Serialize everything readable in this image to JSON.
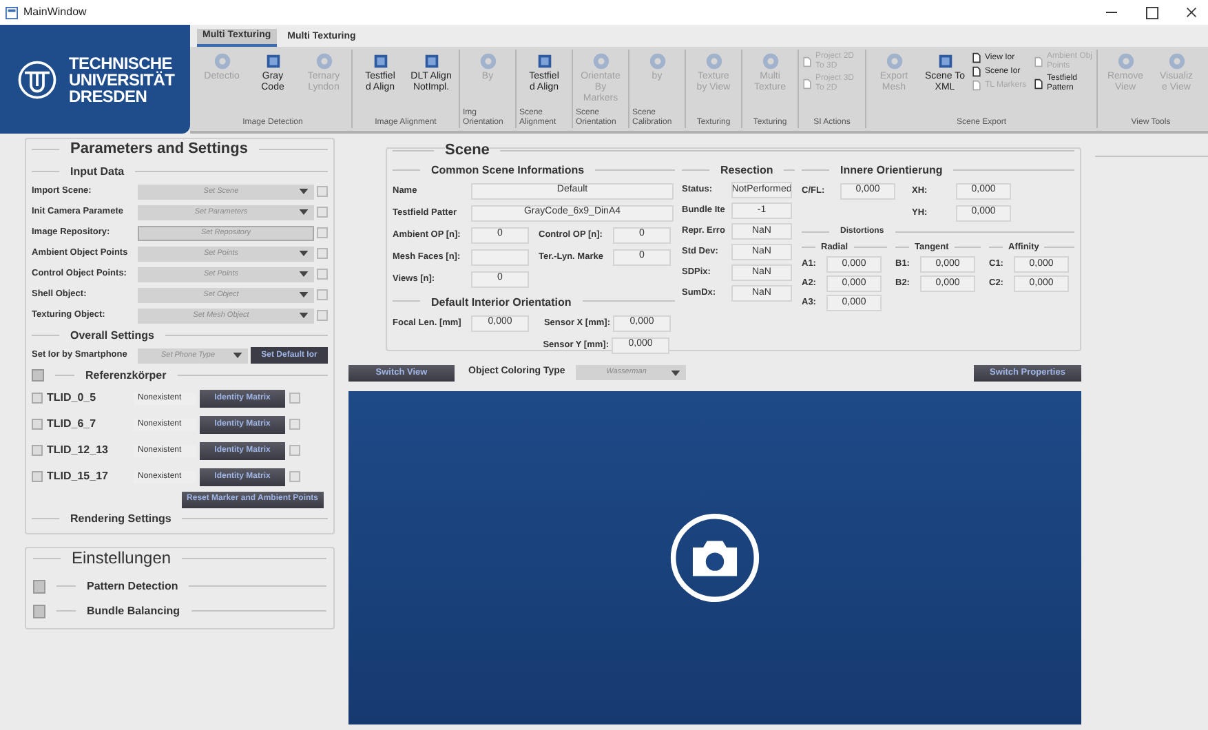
{
  "window": {
    "title": "MainWindow"
  },
  "logo": {
    "lines": [
      "TECHNISCHE",
      "UNIVERSITÄT",
      "DRESDEN"
    ]
  },
  "ribbon_tabs": [
    {
      "label": "Multi Texturing",
      "selected": true
    },
    {
      "label": "Multi Texturing",
      "selected": false
    }
  ],
  "toolbar_groups": [
    {
      "label": "Image Detection",
      "buttons": [
        {
          "kind": "large",
          "label": "Detectio",
          "disabled": true
        },
        {
          "kind": "large",
          "label": "Gray\nCode",
          "disabled": false
        },
        {
          "kind": "large",
          "label": "Ternary\nLyndon",
          "disabled": true
        }
      ]
    },
    {
      "label": "Image Alignment",
      "buttons": [
        {
          "kind": "large",
          "label": "Testfiel\nd Align",
          "disabled": false
        },
        {
          "kind": "large",
          "label": "DLT Align\nNotImpl.",
          "disabled": false
        }
      ]
    },
    {
      "label": "Img Orientation",
      "buttons": [
        {
          "kind": "large",
          "label": "By",
          "disabled": true
        }
      ]
    },
    {
      "label": "Scene Alignment",
      "buttons": [
        {
          "kind": "large",
          "label": "Testfiel\nd Align",
          "disabled": false
        }
      ]
    },
    {
      "label": "Scene Orientation",
      "buttons": [
        {
          "kind": "large",
          "label": "Orientate By\nMarkers",
          "disabled": true
        }
      ]
    },
    {
      "label": "Scene Calibration",
      "buttons": [
        {
          "kind": "large",
          "label": "by",
          "disabled": true
        }
      ]
    },
    {
      "label": "Texturing",
      "buttons": [
        {
          "kind": "large",
          "label": "Texture\nby View",
          "disabled": true
        }
      ]
    },
    {
      "label": "Texturing",
      "buttons": [
        {
          "kind": "large",
          "label": "Multi\nTexture",
          "disabled": true
        }
      ]
    },
    {
      "label": "SI Actions",
      "buttons": [
        {
          "kind": "small",
          "label": "Project 2D To 3D",
          "disabled": true
        },
        {
          "kind": "small",
          "label": "Project 3D To 2D",
          "disabled": true
        }
      ]
    },
    {
      "label": "Scene Export",
      "buttons": [
        {
          "kind": "large",
          "label": "Export\nMesh",
          "disabled": true
        },
        {
          "kind": "large",
          "label": "Scene To\nXML",
          "disabled": false
        },
        {
          "kind": "small",
          "label": "View Ior",
          "disabled": false
        },
        {
          "kind": "small",
          "label": "Scene Ior",
          "disabled": false
        },
        {
          "kind": "small",
          "label": "TL Markers",
          "disabled": true
        },
        {
          "kind": "small",
          "label": "Ambient Obj Points",
          "disabled": true
        },
        {
          "kind": "small",
          "label": "Testfield Pattern",
          "disabled": false
        }
      ]
    },
    {
      "label": "View Tools",
      "buttons": [
        {
          "kind": "large",
          "label": "Remove\nView",
          "disabled": true
        },
        {
          "kind": "large",
          "label": "Visualiz\ne View",
          "disabled": true
        }
      ]
    }
  ],
  "parameters": {
    "title": "Parameters and Settings",
    "input_data": {
      "title": "Input Data",
      "rows": [
        {
          "label": "Import Scene:",
          "value": "Set Scene",
          "kind": "dropdown"
        },
        {
          "label": "Init Camera Paramete",
          "value": "Set Parameters",
          "kind": "dropdown"
        },
        {
          "label": "Image Repository:",
          "value": "Set Repository",
          "kind": "field"
        },
        {
          "label": "Ambient Object Points",
          "value": "Set Points",
          "kind": "dropdown"
        },
        {
          "label": "Control Object Points:",
          "value": "Set Points",
          "kind": "dropdown"
        },
        {
          "label": "Shell Object:",
          "value": "Set Object",
          "kind": "dropdown"
        },
        {
          "label": "Texturing Object:",
          "value": "Set Mesh Object",
          "kind": "dropdown"
        }
      ]
    },
    "overall_settings": {
      "title": "Overall Settings",
      "label": "Set Ior by Smartphone",
      "value": "Set Phone Type",
      "button": "Set Default Ior"
    },
    "referenzkoerper": {
      "title": "Referenzkörper",
      "items": [
        {
          "name": "TLID_0_5",
          "checked": false,
          "status": "Nonexistent",
          "button": "Identity Matrix"
        },
        {
          "name": "TLID_6_7",
          "checked": false,
          "status": "Nonexistent",
          "button": "Identity Matrix"
        },
        {
          "name": "TLID_12_13",
          "checked": false,
          "status": "Nonexistent",
          "button": "Identity Matrix"
        },
        {
          "name": "TLID_15_17",
          "checked": false,
          "status": "Nonexistent",
          "button": "Identity Matrix"
        }
      ],
      "reset_button": "Reset Marker and Ambient Points"
    },
    "rendering_title": "Rendering Settings"
  },
  "einstellungen": {
    "title": "Einstellungen",
    "sections": [
      "Pattern Detection",
      "Bundle Balancing"
    ]
  },
  "scene": {
    "title": "Scene",
    "common": {
      "title": "Common Scene Informations",
      "rows": [
        [
          {
            "label": "Name",
            "value": "Default"
          }
        ],
        [
          {
            "label": "Testfield Patter",
            "value": "GrayCode_6x9_DinA4"
          }
        ],
        [
          {
            "label": "Ambient OP [n]:",
            "value": "0"
          },
          {
            "label": "Control OP [n]:",
            "value": "0"
          }
        ],
        [
          {
            "label": "Mesh Faces [n]:"
          },
          {
            "label": "Ter.-Lyn. Marke",
            "value": "0"
          }
        ],
        [
          {
            "label": "Views [n]:",
            "value": "0"
          }
        ]
      ]
    },
    "interior": {
      "title": "Default Interior Orientation",
      "focal": {
        "label": "Focal Len. [mm]",
        "value": "0,000"
      },
      "sensor_x": {
        "label": "Sensor X [mm]:",
        "value": "0,000"
      },
      "sensor_y": {
        "label": "Sensor Y [mm]:",
        "value": "0,000"
      }
    },
    "resection": {
      "title": "Resection",
      "rows": [
        {
          "label": "Status:",
          "value": "NotPerformed"
        },
        {
          "label": "Bundle Ite",
          "value": "-1"
        },
        {
          "label": "Repr. Erro",
          "value": "NaN"
        },
        {
          "label": "Std Dev:",
          "value": "NaN"
        },
        {
          "label": "SDPix:",
          "value": "NaN"
        },
        {
          "label": "SumDx:",
          "value": "NaN"
        }
      ]
    },
    "innere": {
      "title": "Innere Orientierung",
      "cfl": {
        "label": "C/FL:",
        "value": "0,000"
      },
      "xh": {
        "label": "XH:",
        "value": "0,000"
      },
      "yh": {
        "label": "YH:",
        "value": "0,000"
      },
      "distortions_title": "Distortions",
      "columns": [
        {
          "title": "Radial",
          "rows": [
            {
              "label": "A1:",
              "value": "0,000"
            },
            {
              "label": "A2:",
              "value": "0,000"
            },
            {
              "label": "A3:",
              "value": "0,000"
            }
          ]
        },
        {
          "title": "Tangent",
          "rows": [
            {
              "label": "B1:",
              "value": "0,000"
            },
            {
              "label": "B2:",
              "value": "0,000"
            }
          ]
        },
        {
          "title": "Affinity",
          "rows": [
            {
              "label": "C1:",
              "value": "0,000"
            },
            {
              "label": "C2:",
              "value": "0,000"
            }
          ]
        }
      ]
    }
  },
  "view_bar": {
    "switch_view": "Switch View",
    "coloring_label": "Object Coloring Type",
    "coloring_value": "Wasserman",
    "switch_properties": "Switch Properties"
  }
}
